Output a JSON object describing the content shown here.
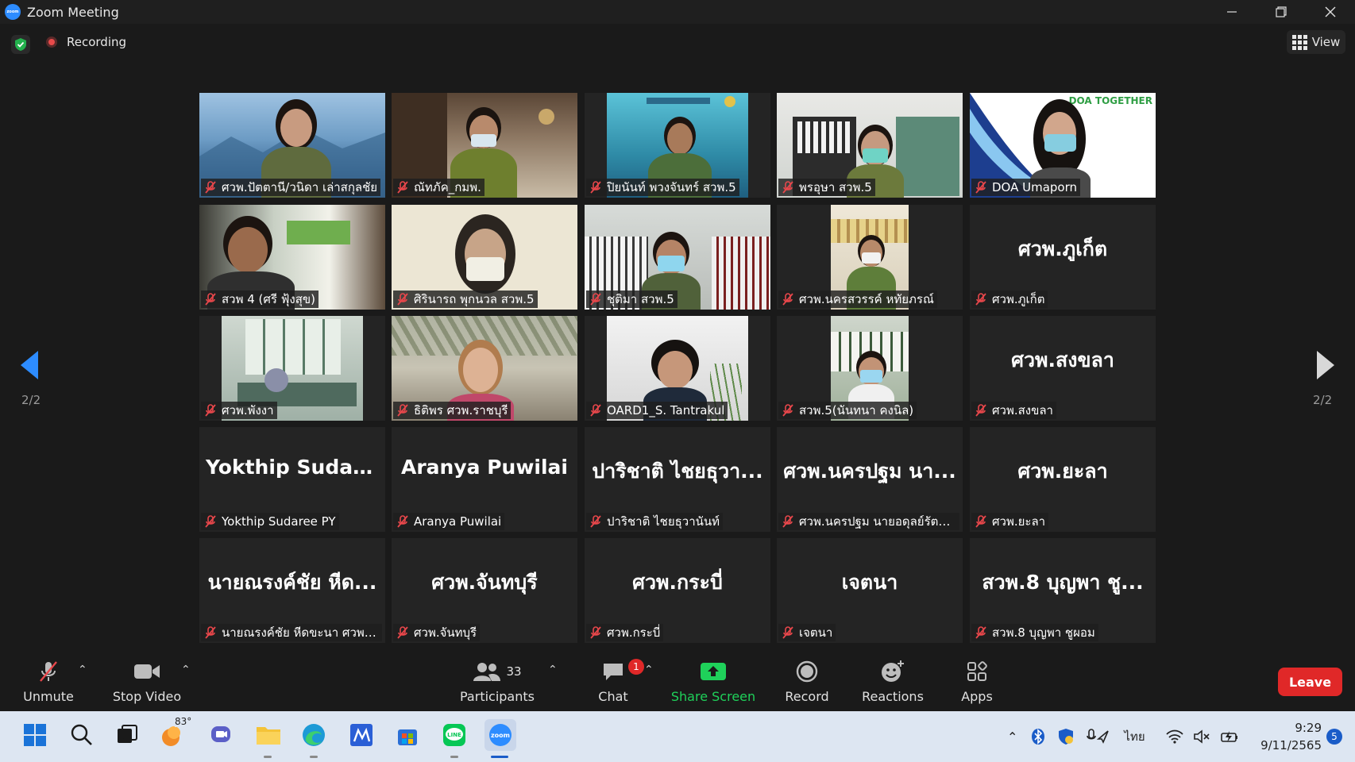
{
  "window": {
    "title": "Zoom Meeting",
    "logo_text": "zoom"
  },
  "status": {
    "recording_label": "Recording",
    "view_label": "View"
  },
  "pager": {
    "left_label": "2/2",
    "right_label": "2/2"
  },
  "tiles": [
    {
      "name": "ศวพ.ปัตตานี/วนิดา เล่าสกุลชัย",
      "big": ""
    },
    {
      "name": "ณัทภัค_กมพ.",
      "big": ""
    },
    {
      "name": "ปิยนันท์ พวงจันทร์ สวพ.5",
      "big": ""
    },
    {
      "name": "พรอุษา สวพ.5",
      "big": ""
    },
    {
      "name": "DOA Umaporn",
      "big": "",
      "overlay_text": "DOA TOGETHER"
    },
    {
      "name": "สวพ 4 (ศรี ฟุ้งสุข)",
      "big": ""
    },
    {
      "name": "ศิรินารถ พุกนวล สวพ.5",
      "big": ""
    },
    {
      "name": "ชุติมา สวพ.5",
      "big": ""
    },
    {
      "name": "ศวพ.นครสวรรค์ หทัยภรณ์",
      "big": ""
    },
    {
      "name": "ศวพ.ภูเก็ต",
      "big": "ศวพ.ภูเก็ต"
    },
    {
      "name": "ศวพ.พังงา",
      "big": ""
    },
    {
      "name": "ธิติพร ศวพ.ราชบุรี",
      "big": ""
    },
    {
      "name": "OARD1_S. Tantrakul",
      "big": ""
    },
    {
      "name": "สวพ.5(นันทนา คงนิล)",
      "big": ""
    },
    {
      "name": "ศวพ.สงขลา",
      "big": "ศวพ.สงขลา"
    },
    {
      "name": "Yokthip Sudaree PY",
      "big": "Yokthip  Sudare..."
    },
    {
      "name": "Aranya Puwilai",
      "big": "Aranya Puwilai"
    },
    {
      "name": "ปาริชาติ ไชยธุวานันท์",
      "big": "ปาริชาติ ไชยธุวา..."
    },
    {
      "name": "ศวพ.นครปฐม นายอดุลย์รัตน์ ...",
      "big": "ศวพ.นครปฐม นา..."
    },
    {
      "name": "ศวพ.ยะลา",
      "big": "ศวพ.ยะลา"
    },
    {
      "name": "นายณรงค์ชัย หีดขะนา ศวพ.รน.",
      "big": "นายณรงค์ชัย หีด..."
    },
    {
      "name": "ศวพ.จันทบุรี",
      "big": "ศวพ.จันทบุรี"
    },
    {
      "name": "ศวพ.กระบี่",
      "big": "ศวพ.กระบี่"
    },
    {
      "name": "เจตนา",
      "big": "เจตนา"
    },
    {
      "name": "สวพ.8 บุญพา ชูผอม",
      "big": "สวพ.8 บุญพา  ชู..."
    }
  ],
  "toolbar": {
    "unmute": "Unmute",
    "stop_video": "Stop Video",
    "participants": "Participants",
    "participants_count": "33",
    "chat": "Chat",
    "chat_badge": "1",
    "share_screen": "Share Screen",
    "record": "Record",
    "reactions": "Reactions",
    "apps": "Apps",
    "leave": "Leave"
  },
  "taskbar": {
    "weather_temp": "83°",
    "language": "ไทย",
    "time": "9:29",
    "date": "9/11/2565",
    "notification_count": "5",
    "line_label": "LINE",
    "zoom_label": "zoom"
  },
  "colors": {
    "share_green": "#1fd15a",
    "leave_red": "#e02828",
    "mic_muted_red": "#e8474b",
    "zoom_blue": "#2d8cff"
  }
}
